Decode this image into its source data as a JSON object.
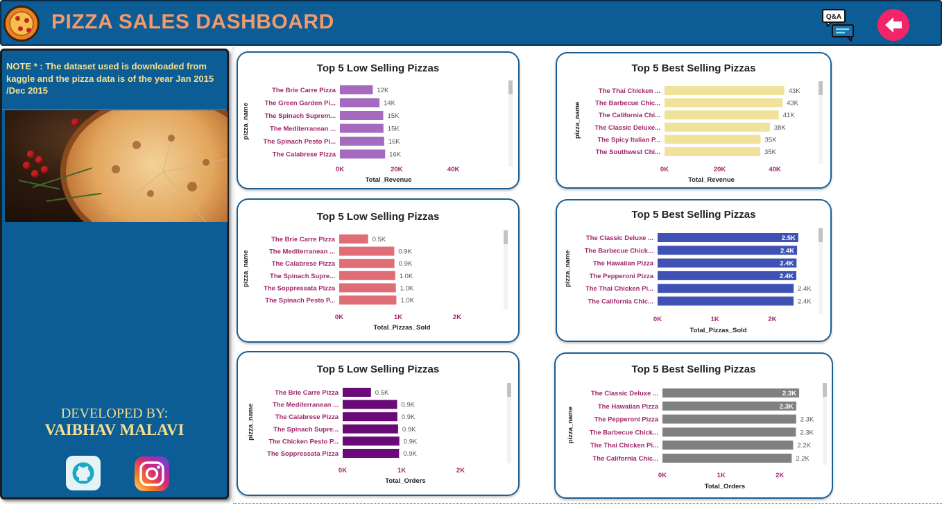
{
  "header": {
    "title": "PIZZA SALES DASHBOARD",
    "qa_label": "Q&A",
    "colors": {
      "bar": "#0c5c96",
      "title": "#f29a6a",
      "back_button": "#f2246a"
    }
  },
  "sidebar": {
    "note": "NOTE * : The dataset  used is downloaded from kaggle and the pizza data is of the year  Jan 2015 /Dec 2015",
    "developed_by_label": "DEVELOPED BY:",
    "developer_name": "VAIBHAV MALAVI",
    "icons": [
      "github-icon",
      "instagram-icon"
    ],
    "colors": {
      "background": "#0c5c96",
      "text": "#f5e08c"
    }
  },
  "chart_data": [
    {
      "id": "low-revenue",
      "type": "bar",
      "orientation": "horizontal",
      "title": "Top 5 Low Selling Pizzas",
      "ylabel": "pizza_name",
      "xlabel": "Total_Revenue",
      "categories": [
        "The Brie Carre Pizza",
        "The Green Garden Pi...",
        "The Spinach Suprem...",
        "The Mediterranean ...",
        "The Spinach Pesto Pi...",
        "The Calabrese Pizza"
      ],
      "values": [
        11588,
        13956,
        15278,
        15360,
        15596,
        15934
      ],
      "data_labels": [
        "12K",
        "14K",
        "15K",
        "15K",
        "16K",
        "16K"
      ],
      "x_ticks": [
        "0K",
        "20K",
        "40K"
      ],
      "xlim": [
        0,
        44000
      ],
      "color": "#a569bd",
      "label_inside": [
        false,
        false,
        false,
        false,
        false,
        false
      ]
    },
    {
      "id": "best-revenue",
      "type": "bar",
      "orientation": "horizontal",
      "title": "Top 5 Best Selling Pizzas",
      "ylabel": "pizza_name",
      "xlabel": "Total_Revenue",
      "categories": [
        "The Thai Chicken ...",
        "The Barbecue Chic...",
        "The California Chi...",
        "The Classic Deluxe...",
        "The Spicy Italian P...",
        "The Southwest Chi..."
      ],
      "values": [
        43434,
        42768,
        41410,
        38180,
        34831,
        34705
      ],
      "data_labels": [
        "43K",
        "43K",
        "41K",
        "38K",
        "35K",
        "35K"
      ],
      "x_ticks": [
        "0K",
        "20K",
        "40K"
      ],
      "xlim": [
        0,
        44000
      ],
      "color": "#f1e29b",
      "label_inside": [
        false,
        false,
        false,
        false,
        false,
        false
      ]
    },
    {
      "id": "low-pizzas-sold",
      "type": "bar",
      "orientation": "horizontal",
      "title": "Top 5 Low Selling Pizzas",
      "ylabel": "pizza_name",
      "xlabel": "Total_Pizzas_Sold",
      "categories": [
        "The Brie Carre Pizza",
        "The Mediterranean ...",
        "The Calabrese Pizza",
        "The Spinach Supre...",
        "The Soppressata Pizza",
        "The Spinach Pesto P..."
      ],
      "values": [
        490,
        934,
        937,
        950,
        961,
        970
      ],
      "data_labels": [
        "0.5K",
        "0.9K",
        "0.9K",
        "1.0K",
        "1.0K",
        "1.0K"
      ],
      "x_ticks": [
        "0K",
        "1K",
        "2K"
      ],
      "xlim": [
        0,
        2600
      ],
      "color": "#e06c75",
      "label_inside": [
        false,
        false,
        false,
        false,
        false,
        false
      ]
    },
    {
      "id": "best-pizzas-sold",
      "type": "bar",
      "orientation": "horizontal",
      "title": "Top 5 Best Selling Pizzas",
      "ylabel": "pizza_name",
      "xlabel": "Total_Pizzas_Sold",
      "categories": [
        "The Classic Deluxe ...",
        "The Barbecue Chick...",
        "The Hawaiian Pizza",
        "The Pepperoni Pizza",
        "The Thai Chicken Pi...",
        "The California Chic..."
      ],
      "values": [
        2453,
        2432,
        2422,
        2418,
        2371,
        2370
      ],
      "data_labels": [
        "2.5K",
        "2.4K",
        "2.4K",
        "2.4K",
        "2.4K",
        "2.4K"
      ],
      "x_ticks": [
        "0K",
        "1K",
        "2K"
      ],
      "xlim": [
        0,
        2600
      ],
      "color": "#3f51b5",
      "label_inside": [
        true,
        true,
        true,
        true,
        false,
        false
      ]
    },
    {
      "id": "low-orders",
      "type": "bar",
      "orientation": "horizontal",
      "title": "Top 5 Low Selling Pizzas",
      "ylabel": "pizza_name",
      "xlabel": "Total_Orders",
      "categories": [
        "The Brie Carre Pizza",
        "The Mediterranean ...",
        "The Calabrese Pizza",
        "The Spinach Supre...",
        "The Chicken Pesto P...",
        "The Soppressata Pizza"
      ],
      "values": [
        480,
        923,
        927,
        940,
        961,
        957
      ],
      "data_labels": [
        "0.5K",
        "0.9K",
        "0.9K",
        "0.9K",
        "0.9K",
        "0.9K"
      ],
      "x_ticks": [
        "0K",
        "1K",
        "2K"
      ],
      "xlim": [
        0,
        2600
      ],
      "color": "#6a0a78",
      "label_inside": [
        false,
        false,
        false,
        false,
        false,
        false
      ]
    },
    {
      "id": "best-orders",
      "type": "bar",
      "orientation": "horizontal",
      "title": "Top 5 Best Selling Pizzas",
      "ylabel": "pizza_name",
      "xlabel": "Total_Orders",
      "categories": [
        "The Classic Deluxe ...",
        "The Hawaiian Pizza",
        "The Pepperoni Pizza",
        "The Barbecue Chick...",
        "The Thai Chicken Pi...",
        "The California Chic..."
      ],
      "values": [
        2329,
        2280,
        2278,
        2273,
        2225,
        2202
      ],
      "data_labels": [
        "2.3K",
        "2.3K",
        "2.3K",
        "2.3K",
        "2.2K",
        "2.2K"
      ],
      "x_ticks": [
        "0K",
        "1K",
        "2K"
      ],
      "xlim": [
        0,
        2600
      ],
      "color": "#808080",
      "label_inside": [
        true,
        true,
        false,
        false,
        false,
        false
      ]
    }
  ]
}
